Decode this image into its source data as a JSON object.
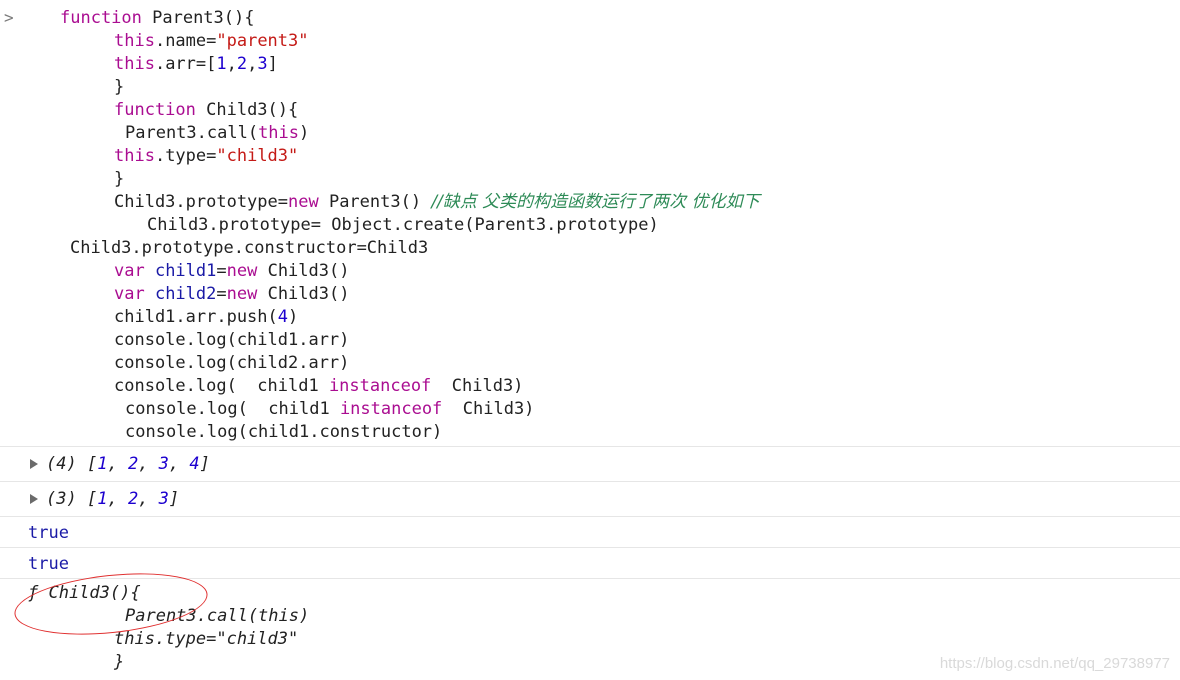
{
  "prompt_symbol": ">",
  "code": {
    "l1_kw": "function",
    "l1_rest": " Parent3(){",
    "l2_kw": "this",
    "l2_mid": ".name=",
    "l2_str": "\"parent3\"",
    "l3_kw": "this",
    "l3_mid": ".arr=[",
    "l3_n1": "1",
    "l3_c1": ",",
    "l3_n2": "2",
    "l3_c2": ",",
    "l3_n3": "3",
    "l3_end": "]",
    "l4": "}",
    "l5_kw": "function",
    "l5_rest": " Child3(){",
    "l6_pre": "Parent3.call(",
    "l6_kw": "this",
    "l6_end": ")",
    "l7_kw": "this",
    "l7_mid": ".type=",
    "l7_str": "\"child3\"",
    "l8": "}",
    "l9_pre": "Child3.prototype=",
    "l9_kw": "new",
    "l9_mid": " Parent3() ",
    "l9_cmt": "//缺点 父类的构造函数运行了两次 优化如下",
    "l10": "Child3.prototype= Object.create(Parent3.prototype)",
    "l11": "Child3.prototype.constructor=Child3",
    "l12_kw1": "var",
    "l12_var": " child1",
    "l12_eq": "=",
    "l12_kw2": "new",
    "l12_end": " Child3()",
    "l13_kw1": "var",
    "l13_var": " child2",
    "l13_eq": "=",
    "l13_kw2": "new",
    "l13_end": " Child3()",
    "l14_pre": "child1.arr.push(",
    "l14_num": "4",
    "l14_end": ")",
    "l15": "console.log(child1.arr)",
    "l16": "console.log(child2.arr)",
    "l17_pre": "console.log(  child1 ",
    "l17_kw": "instanceof",
    "l17_end": "  Child3)",
    "l18_pre": "console.log(  child1 ",
    "l18_kw": "instanceof",
    "l18_end": "  Child3)",
    "l19": "console.log(child1.constructor)"
  },
  "outputs": {
    "o1_len": "(4)",
    "o1_open": " [",
    "o1_v1": "1",
    "o1_s1": ", ",
    "o1_v2": "2",
    "o1_s2": ", ",
    "o1_v3": "3",
    "o1_s3": ", ",
    "o1_v4": "4",
    "o1_close": "]",
    "o2_len": "(3)",
    "o2_open": " [",
    "o2_v1": "1",
    "o2_s1": ", ",
    "o2_v2": "2",
    "o2_s2": ", ",
    "o2_v3": "3",
    "o2_close": "]",
    "o3": "true",
    "o4": "true",
    "o5_l1": "ƒ Child3(){",
    "o5_l2": "Parent3.call(this)",
    "o5_l3": "this.type=\"child3\"",
    "o5_l4": "}"
  },
  "watermark": "https://blog.csdn.net/qq_29738977",
  "colors": {
    "keyword": "#aa0d91",
    "string": "#c41a16",
    "number": "#1c00cf",
    "variable": "#1a1aa6",
    "comment": "#2e8b57",
    "annotation": "#e03030"
  }
}
